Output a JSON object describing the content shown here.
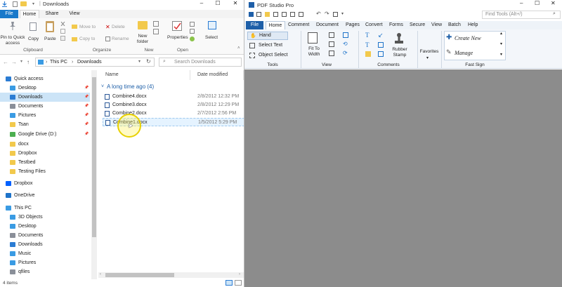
{
  "explorer": {
    "title": "Downloads",
    "tabs": [
      "File",
      "Home",
      "Share",
      "View"
    ],
    "ribbon": {
      "pin_label": "Pin to Quick access",
      "copy_label": "Copy",
      "paste_label": "Paste",
      "move_to_label": "Move to",
      "copy_to_label": "Copy to",
      "delete_label": "Delete",
      "rename_label": "Rename",
      "new_folder_label": "New folder",
      "properties_label": "Properties",
      "select_label": "Select",
      "groups": [
        "Clipboard",
        "Organize",
        "New",
        "Open"
      ]
    },
    "address": {
      "this_pc": "This PC",
      "downloads": "Downloads",
      "search_placeholder": "Search Downloads"
    },
    "nav": [
      {
        "label": "Quick access",
        "icon": "star-icon",
        "color": "#2b7cd3",
        "pinned": false,
        "selected": false
      },
      {
        "label": "Desktop",
        "icon": "desktop-icon",
        "color": "#3a9be3",
        "pinned": true,
        "selected": false
      },
      {
        "label": "Downloads",
        "icon": "download-icon",
        "color": "#2b7cd3",
        "pinned": true,
        "selected": true
      },
      {
        "label": "Documents",
        "icon": "documents-icon",
        "color": "#8a8f99",
        "pinned": true,
        "selected": false
      },
      {
        "label": "Pictures",
        "icon": "pictures-icon",
        "color": "#3a9be3",
        "pinned": true,
        "selected": false
      },
      {
        "label": "Tsan",
        "icon": "folder-icon",
        "color": "#f2c94c",
        "pinned": true,
        "selected": false
      },
      {
        "label": "Google Drive (D:)",
        "icon": "drive-icon",
        "color": "#4caf50",
        "pinned": true,
        "selected": false
      },
      {
        "label": "docx",
        "icon": "folder-icon",
        "color": "#f2c94c",
        "pinned": false,
        "selected": false
      },
      {
        "label": "Dropbox",
        "icon": "folder-icon",
        "color": "#f2c94c",
        "pinned": false,
        "selected": false
      },
      {
        "label": "Testbed",
        "icon": "folder-icon",
        "color": "#f2c94c",
        "pinned": false,
        "selected": false
      },
      {
        "label": "Testing Files",
        "icon": "folder-icon",
        "color": "#f2c94c",
        "pinned": false,
        "selected": false
      },
      {
        "label": "Dropbox",
        "icon": "dropbox-icon",
        "color": "#0061ff",
        "pinned": false,
        "selected": false
      },
      {
        "label": "OneDrive",
        "icon": "cloud-icon",
        "color": "#1e73c9",
        "pinned": false,
        "selected": false
      },
      {
        "label": "This PC",
        "icon": "computer-icon",
        "color": "#3a9be3",
        "pinned": false,
        "selected": false
      },
      {
        "label": "3D Objects",
        "icon": "cube-icon",
        "color": "#3a9be3",
        "pinned": false,
        "selected": false
      },
      {
        "label": "Desktop",
        "icon": "desktop-icon",
        "color": "#3a9be3",
        "pinned": false,
        "selected": false
      },
      {
        "label": "Documents",
        "icon": "documents-icon",
        "color": "#8a8f99",
        "pinned": false,
        "selected": false
      },
      {
        "label": "Downloads",
        "icon": "download-icon",
        "color": "#2b7cd3",
        "pinned": false,
        "selected": false
      },
      {
        "label": "Music",
        "icon": "music-icon",
        "color": "#3a9be3",
        "pinned": false,
        "selected": false
      },
      {
        "label": "Pictures",
        "icon": "pictures-icon",
        "color": "#3a9be3",
        "pinned": false,
        "selected": false
      },
      {
        "label": "qfiles",
        "icon": "drive-icon",
        "color": "#8a8f99",
        "pinned": false,
        "selected": false
      }
    ],
    "columns": {
      "name": "Name",
      "date": "Date modified"
    },
    "group_header": "A long time ago (4)",
    "files": [
      {
        "name": "Combine4.docx",
        "date": "2/8/2012 12:32 PM"
      },
      {
        "name": "Combine3.docx",
        "date": "2/8/2012 12:29 PM"
      },
      {
        "name": "Combine2.docx",
        "date": "2/7/2012 2:56 PM"
      },
      {
        "name": "Combine1.docx",
        "date": "1/5/2012 5:29 PM"
      }
    ],
    "status": "4 items"
  },
  "pdf": {
    "title": "PDF Studio Pro",
    "find_placeholder": "Find Tools  (Alt+/)",
    "menu": [
      "File",
      "Home",
      "Comment",
      "Document",
      "Pages",
      "Convert",
      "Forms",
      "Secure",
      "View",
      "Batch",
      "Help"
    ],
    "tools": {
      "hand": "Hand",
      "select_text": "Select Text",
      "object_select": "Object Select"
    },
    "fit_to_width": "Fit To Width",
    "rubber_stamp": "Rubber Stamp",
    "favorites": "Favorites",
    "fast_sign": {
      "create_new": "Create New",
      "manage": "Manage"
    },
    "groups": [
      "Tools",
      "View",
      "Comments",
      "Fast Sign"
    ]
  }
}
